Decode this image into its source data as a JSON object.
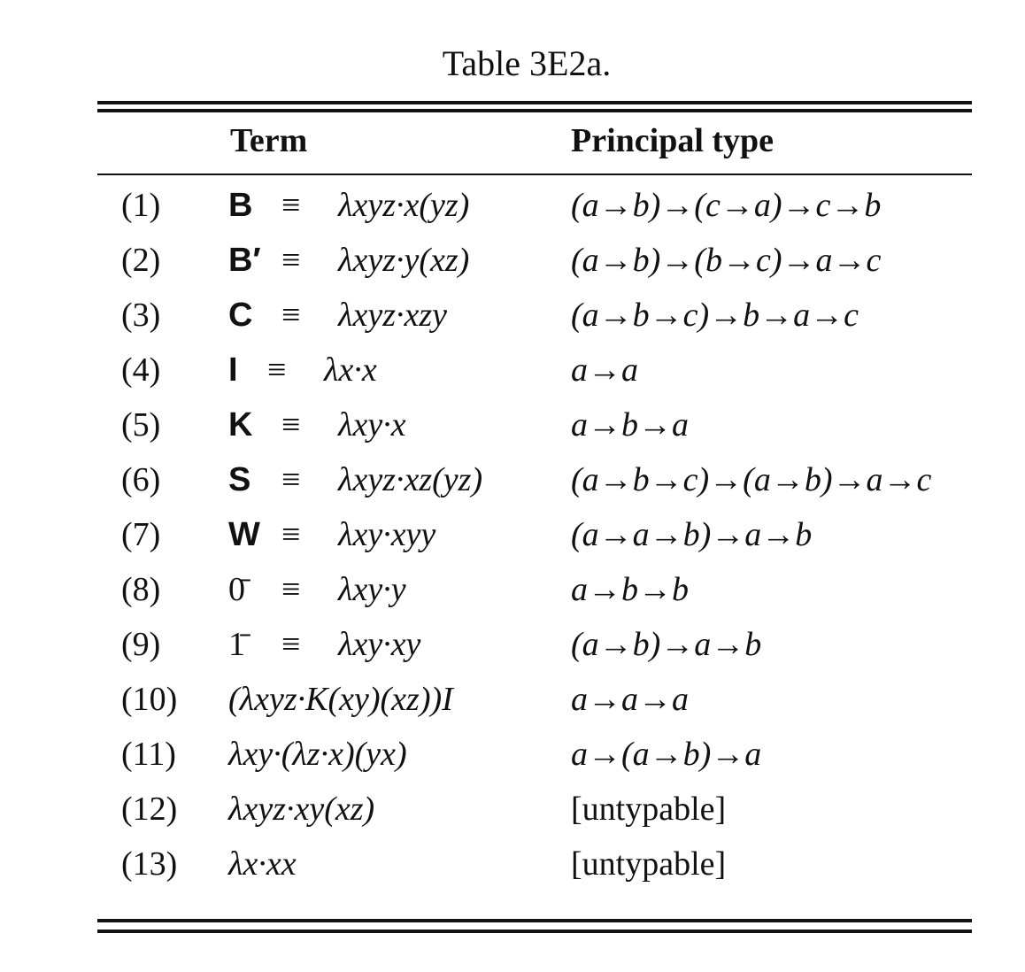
{
  "caption": "Table 3E2a.",
  "headers": {
    "term": "Term",
    "type": "Principal type"
  },
  "rows": [
    {
      "num": "(1)",
      "name": "B",
      "eq": "≡",
      "lambda": "λxyz·x(yz)",
      "type": "(a→b)→(c→a)→c→b"
    },
    {
      "num": "(2)",
      "name": "B′",
      "eq": "≡",
      "lambda": "λxyz·y(xz)",
      "type": "(a→b)→(b→c)→a→c"
    },
    {
      "num": "(3)",
      "name": "C",
      "eq": "≡",
      "lambda": "λxyz·xzy",
      "type": "(a→b→c)→b→a→c"
    },
    {
      "num": "(4)",
      "name": "I",
      "eq": "≡",
      "lambda": "λx·x",
      "type": "a→a"
    },
    {
      "num": "(5)",
      "name": "K",
      "eq": "≡",
      "lambda": "λxy·x",
      "type": "a→b→a"
    },
    {
      "num": "(6)",
      "name": "S",
      "eq": "≡",
      "lambda": "λxyz·xz(yz)",
      "type": "(a→b→c)→(a→b)→a→c"
    },
    {
      "num": "(7)",
      "name": "W",
      "eq": "≡",
      "lambda": "λxy·xyy",
      "type": "(a→a→b)→a→b"
    },
    {
      "num": "(8)",
      "name": "0̄",
      "eq": "≡",
      "lambda": "λxy·y",
      "type": "a→b→b"
    },
    {
      "num": "(9)",
      "name": "1̄",
      "eq": "≡",
      "lambda": "λxy·xy",
      "type": "(a→b)→a→b"
    },
    {
      "num": "(10)",
      "term": "(λxyz·K(xy)(xz))I",
      "type": "a→a→a"
    },
    {
      "num": "(11)",
      "term": "λxy·(λz·x)(yx)",
      "type": "a→(a→b)→a"
    },
    {
      "num": "(12)",
      "term": "λxyz·xy(xz)",
      "type": "[untypable]"
    },
    {
      "num": "(13)",
      "term": "λx·xx",
      "type": "[untypable]"
    }
  ]
}
